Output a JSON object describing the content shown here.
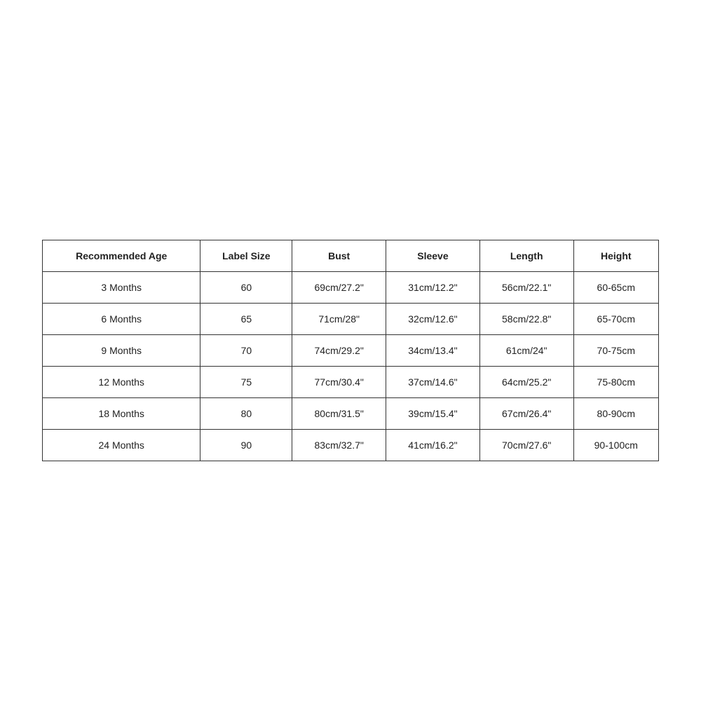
{
  "table": {
    "headers": [
      "Recommended Age",
      "Label Size",
      "Bust",
      "Sleeve",
      "Length",
      "Height"
    ],
    "rows": [
      {
        "age": "3 Months",
        "label_size": "60",
        "bust": "69cm/27.2\"",
        "sleeve": "31cm/12.2\"",
        "length": "56cm/22.1\"",
        "height": "60-65cm"
      },
      {
        "age": "6 Months",
        "label_size": "65",
        "bust": "71cm/28\"",
        "sleeve": "32cm/12.6\"",
        "length": "58cm/22.8\"",
        "height": "65-70cm"
      },
      {
        "age": "9 Months",
        "label_size": "70",
        "bust": "74cm/29.2\"",
        "sleeve": "34cm/13.4\"",
        "length": "61cm/24\"",
        "height": "70-75cm"
      },
      {
        "age": "12 Months",
        "label_size": "75",
        "bust": "77cm/30.4\"",
        "sleeve": "37cm/14.6\"",
        "length": "64cm/25.2\"",
        "height": "75-80cm"
      },
      {
        "age": "18 Months",
        "label_size": "80",
        "bust": "80cm/31.5\"",
        "sleeve": "39cm/15.4\"",
        "length": "67cm/26.4\"",
        "height": "80-90cm"
      },
      {
        "age": "24 Months",
        "label_size": "90",
        "bust": "83cm/32.7\"",
        "sleeve": "41cm/16.2\"",
        "length": "70cm/27.6\"",
        "height": "90-100cm"
      }
    ]
  }
}
